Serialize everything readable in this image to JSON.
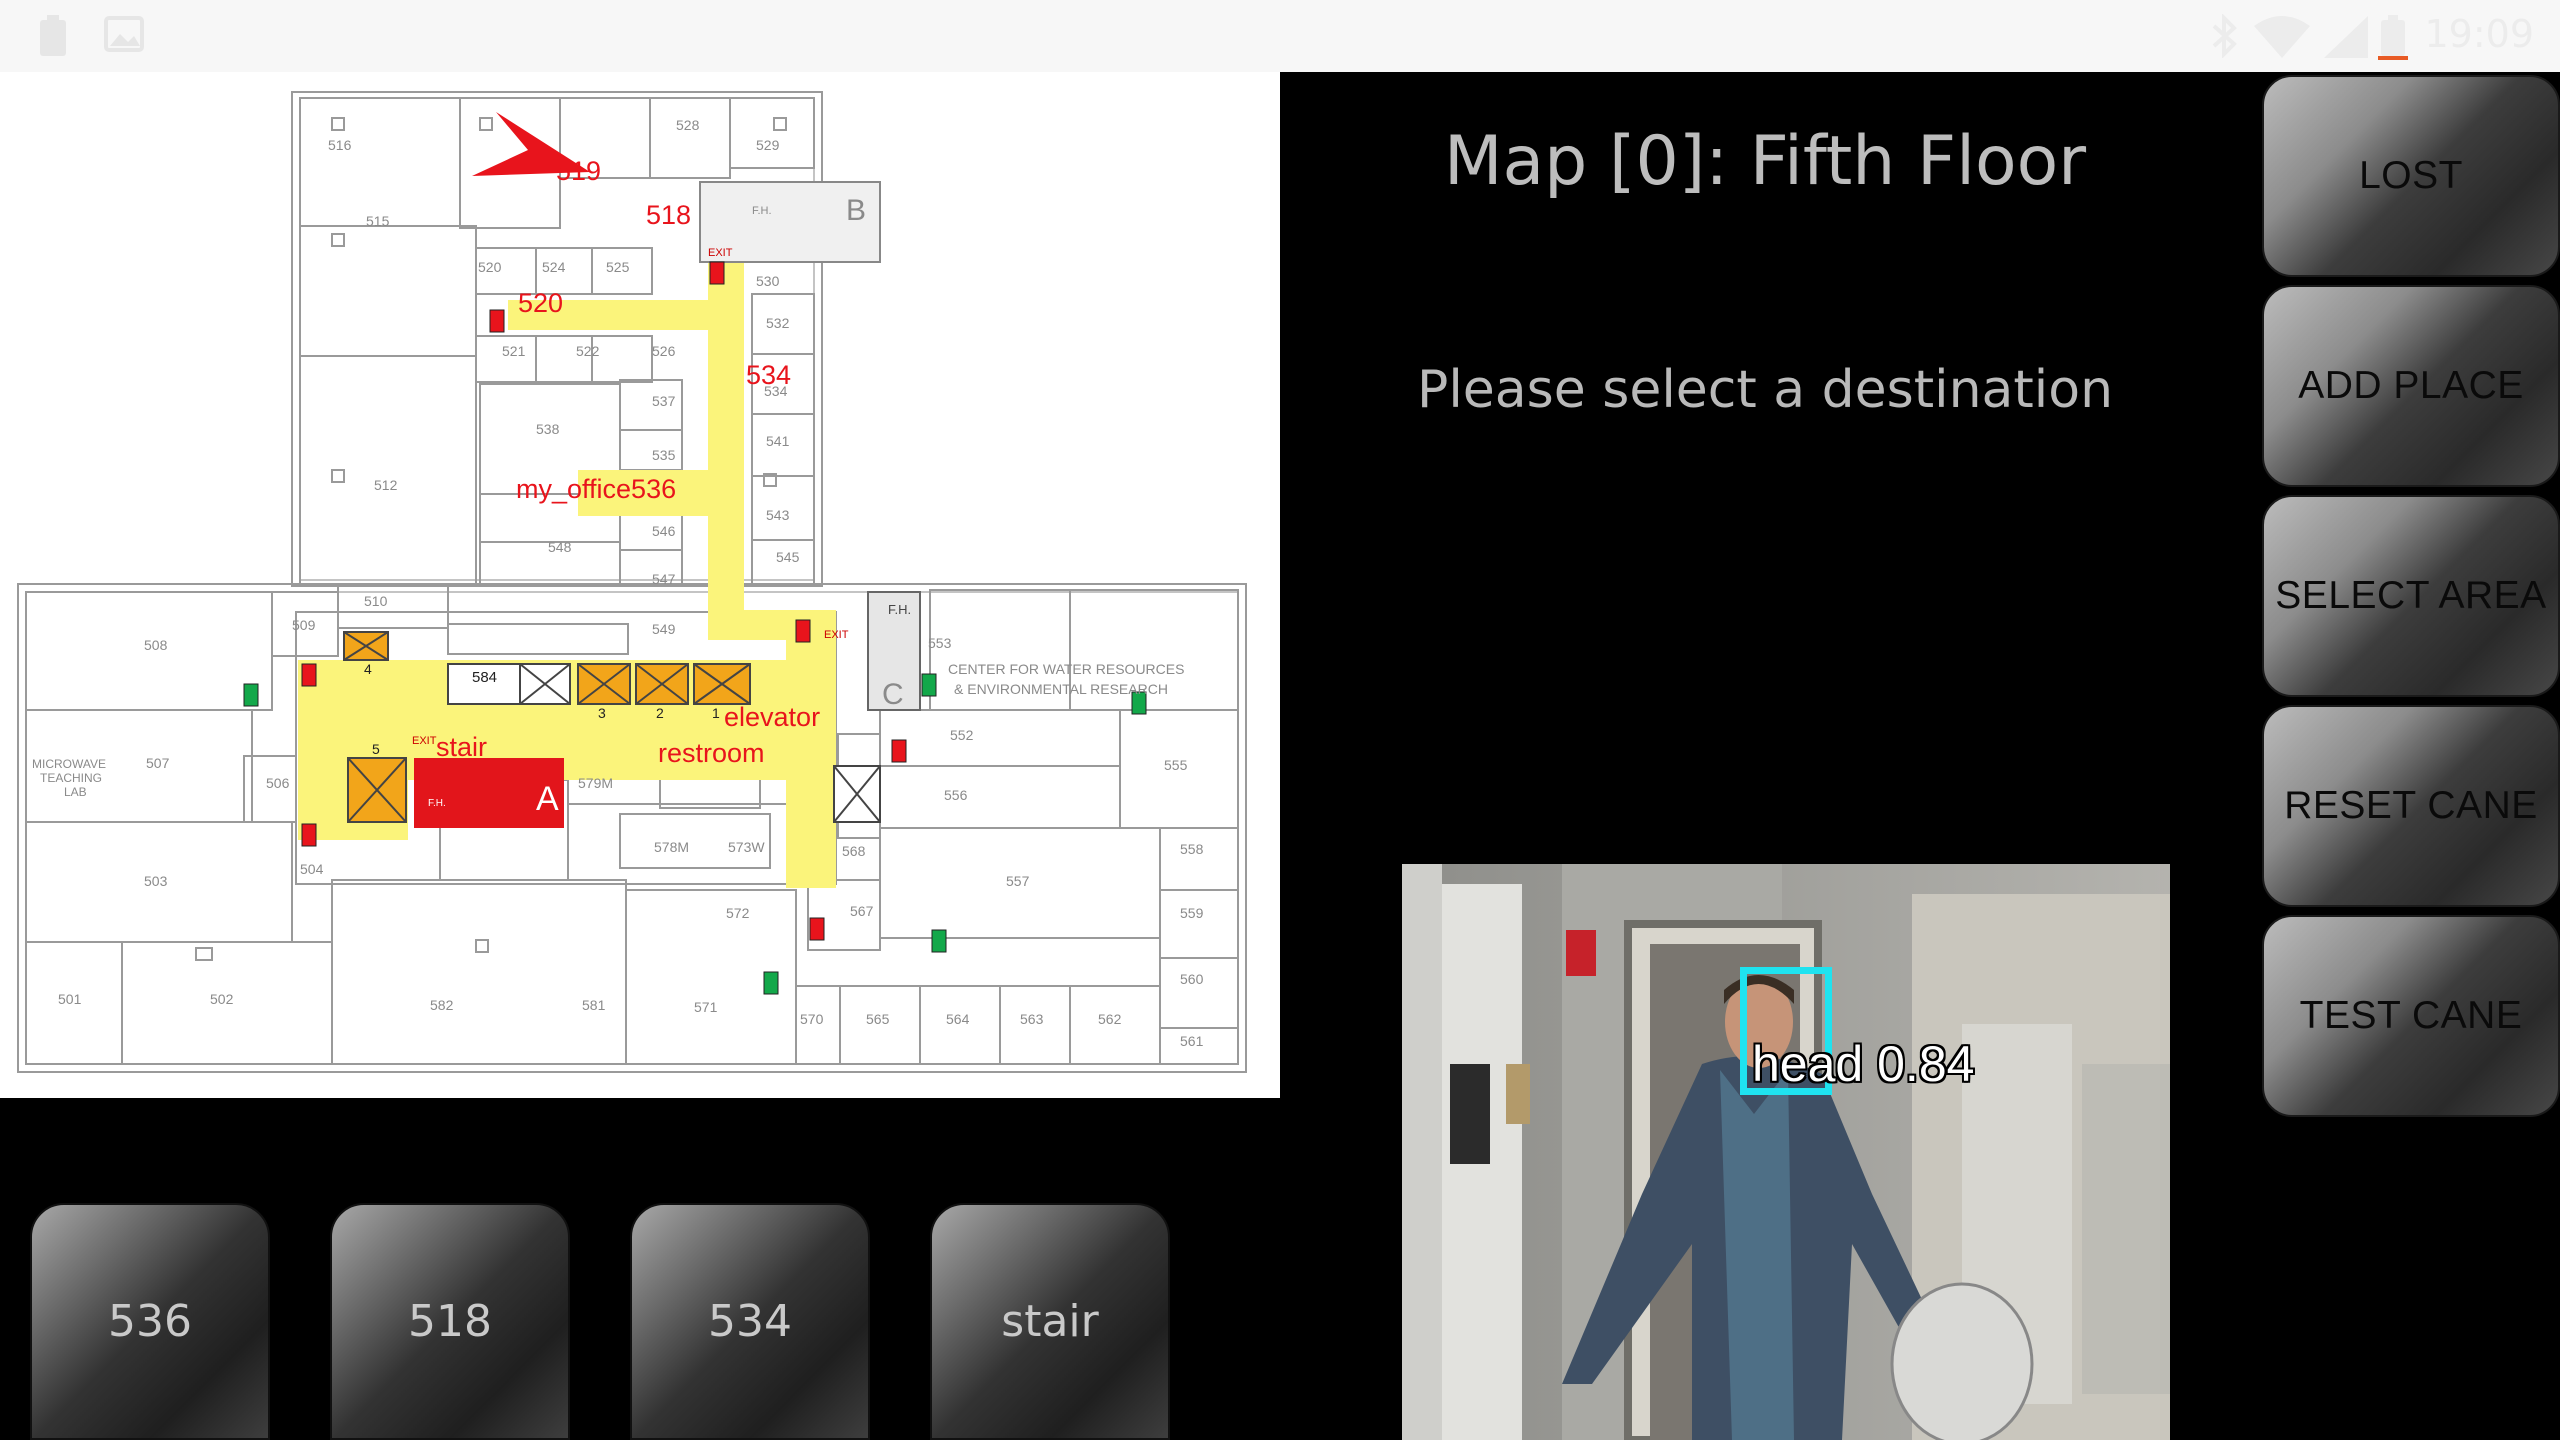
{
  "status_bar": {
    "time": "19:09"
  },
  "info": {
    "map_title": "Map [0]: Fifth Floor",
    "prompt": "Please select a destination"
  },
  "side_buttons": [
    {
      "label": "LOST"
    },
    {
      "label": "ADD PLACE"
    },
    {
      "label": "SELECT AREA"
    },
    {
      "label": "RESET CANE"
    },
    {
      "label": "TEST CANE"
    }
  ],
  "destination_buttons": [
    {
      "label": "536"
    },
    {
      "label": "518"
    },
    {
      "label": "534"
    },
    {
      "label": "stair"
    }
  ],
  "camera": {
    "detection_label": "head 0.84",
    "box_color": "#1fe3f0"
  },
  "map": {
    "colors": {
      "path": "#fbf47b",
      "marker": "#e8141c",
      "elevator": "#f2a51a",
      "stairs": "#e2151b"
    },
    "place_labels": {
      "p519": "519",
      "p518": "518",
      "p520": "520",
      "p534": "534",
      "my_office": "my_office536",
      "elevator": "elevator",
      "restroom": "restroom",
      "stair": "stair"
    },
    "room_numbers": {
      "r516": "516",
      "r528": "528",
      "r529": "529",
      "r515": "515",
      "r520": "520",
      "r524": "524",
      "r525": "525",
      "r530": "530",
      "r521": "521",
      "r522": "522",
      "r526": "526",
      "r532": "532",
      "r537": "537",
      "r538": "538",
      "r541": "541",
      "r535": "535",
      "r512": "512",
      "r543": "543",
      "r548": "548",
      "r546": "546",
      "r545": "545",
      "r547": "547",
      "r510": "510",
      "r549": "549",
      "r508": "508",
      "r509": "509",
      "r584": "584",
      "r553": "553",
      "r552": "552",
      "r555": "555",
      "r556": "556",
      "r507": "507",
      "r506": "506",
      "r579m": "579M",
      "r578m": "578M",
      "r573w": "573W",
      "r568": "568",
      "r558": "558",
      "r557": "557",
      "r503": "503",
      "r504": "504",
      "r572": "572",
      "r567": "567",
      "r559": "559",
      "r560": "560",
      "r501": "501",
      "r502": "502",
      "r582": "582",
      "r581": "581",
      "r571": "571",
      "r570": "570",
      "r565": "565",
      "r564": "564",
      "r563": "563",
      "r562": "562",
      "r561": "561",
      "r534": "534"
    },
    "area_labels": {
      "center": "CENTER FOR WATER RESOURCES",
      "center2": "& ENVIRONMENTAL RESEARCH",
      "microwave1": "MICROWAVE",
      "microwave2": "TEACHING",
      "microwave3": "LAB",
      "letter_a": "A",
      "letter_b": "B",
      "letter_c": "C",
      "fh1": "F.H.",
      "fh2": "F.H.",
      "fh3": "F.H.",
      "exit1": "EXIT",
      "exit2": "EXIT",
      "exit3": "EXIT",
      "num1": "1",
      "num2": "2",
      "num3": "3",
      "num4": "4",
      "num5": "5"
    }
  }
}
